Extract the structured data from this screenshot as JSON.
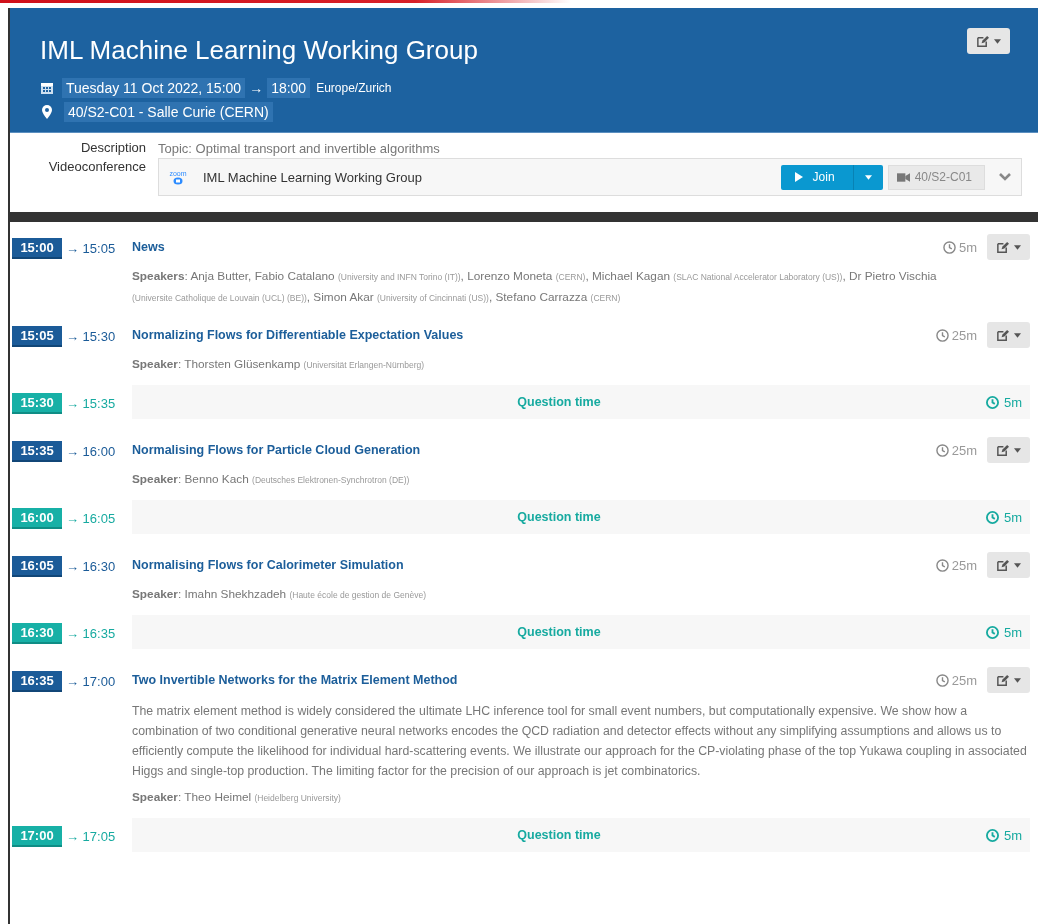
{
  "event": {
    "title": "IML Machine Learning Working Group",
    "start": "Tuesday 11 Oct 2022, 15:00",
    "arrow": "→",
    "end": "18:00",
    "timezone": "Europe/Zurich",
    "location": "40/S2-C01 - Salle Curie (CERN)"
  },
  "details": {
    "description_label": "Description",
    "description": "Topic: Optimal transport and invertible algorithms",
    "video_label": "Videoconference",
    "zoom_logo": "zoom",
    "video_title": "IML Machine Learning Working Group",
    "join": "Join",
    "room": "40/S2-C01"
  },
  "entries": [
    {
      "kind": "talk",
      "start": "15:00",
      "end": "→ 15:05",
      "title": "News",
      "duration": "5m",
      "speaker_label": "**Speakers**:",
      "speakers": [
        {
          "name": "Anja Butter, Fabio Catalano",
          "affiliation": "(University and INFN Torino (IT))",
          "sep": ","
        },
        {
          "name": "Lorenzo Moneta",
          "affiliation": "(CERN)",
          "sep": ","
        },
        {
          "name": "Michael Kagan",
          "affiliation": "(SLAC National Accelerator Laboratory (US))",
          "sep": ","
        },
        {
          "name": "Dr Pietro Vischia",
          "affiliation": "(Universite Catholique de Louvain (UCL) (BE))",
          "sep": ","
        },
        {
          "name": "Simon Akar",
          "affiliation": "(University of Cincinnati (US))",
          "sep": ","
        },
        {
          "name": "Stefano Carrazza",
          "affiliation": "(CERN)"
        }
      ]
    },
    {
      "kind": "talk",
      "start": "15:05",
      "end": "→ 15:30",
      "title": "Normalizing Flows for Differentiable Expectation Values",
      "duration": "25m",
      "speaker_label": "**Speaker**:",
      "speakers": [
        {
          "name": "Thorsten Glüsenkamp",
          "affiliation": "(Universität Erlangen-Nürnberg)"
        }
      ]
    },
    {
      "kind": "break",
      "start": "15:30",
      "end": "→ 15:35",
      "title": "Question time",
      "duration": "5m"
    },
    {
      "kind": "talk",
      "start": "15:35",
      "end": "→ 16:00",
      "title": "Normalising Flows for Particle Cloud Generation",
      "duration": "25m",
      "speaker_label": "**Speaker**:",
      "speakers": [
        {
          "name": "Benno Kach",
          "affiliation": "(Deutsches Elektronen-Synchrotron (DE))"
        }
      ]
    },
    {
      "kind": "break",
      "start": "16:00",
      "end": "→ 16:05",
      "title": "Question time",
      "duration": "5m"
    },
    {
      "kind": "talk",
      "start": "16:05",
      "end": "→ 16:30",
      "title": "Normalising Flows for Calorimeter Simulation",
      "duration": "25m",
      "speaker_label": "**Speaker**:",
      "speakers": [
        {
          "name": "Imahn Shekhzadeh",
          "affiliation": "(Haute école de gestion de Genève)"
        }
      ]
    },
    {
      "kind": "break",
      "start": "16:30",
      "end": "→ 16:35",
      "title": "Question time",
      "duration": "5m"
    },
    {
      "kind": "talk",
      "start": "16:35",
      "end": "→ 17:00",
      "title": "Two Invertible Networks for the Matrix Element Method",
      "duration": "25m",
      "abstract": "The matrix element method is widely considered the ultimate LHC inference tool for small event numbers, but computationally expensive. We show how a combination of two conditional generative neural networks encodes the QCD radiation and detector effects without any simplifying assumptions and allows us to efficiently compute the likelihood for individual hard-scattering events. We illustrate our approach for the CP-violating phase of the top Yukawa coupling in associated Higgs and single-top production. The limiting factor for the precision of our approach is jet combinatorics.",
      "speaker_label": "**Speaker**:",
      "speakers": [
        {
          "name": "Theo Heimel",
          "affiliation": "(Heidelberg University)"
        }
      ]
    },
    {
      "kind": "break",
      "start": "17:00",
      "end": "→ 17:05",
      "title": "Question time",
      "duration": "5m"
    }
  ]
}
